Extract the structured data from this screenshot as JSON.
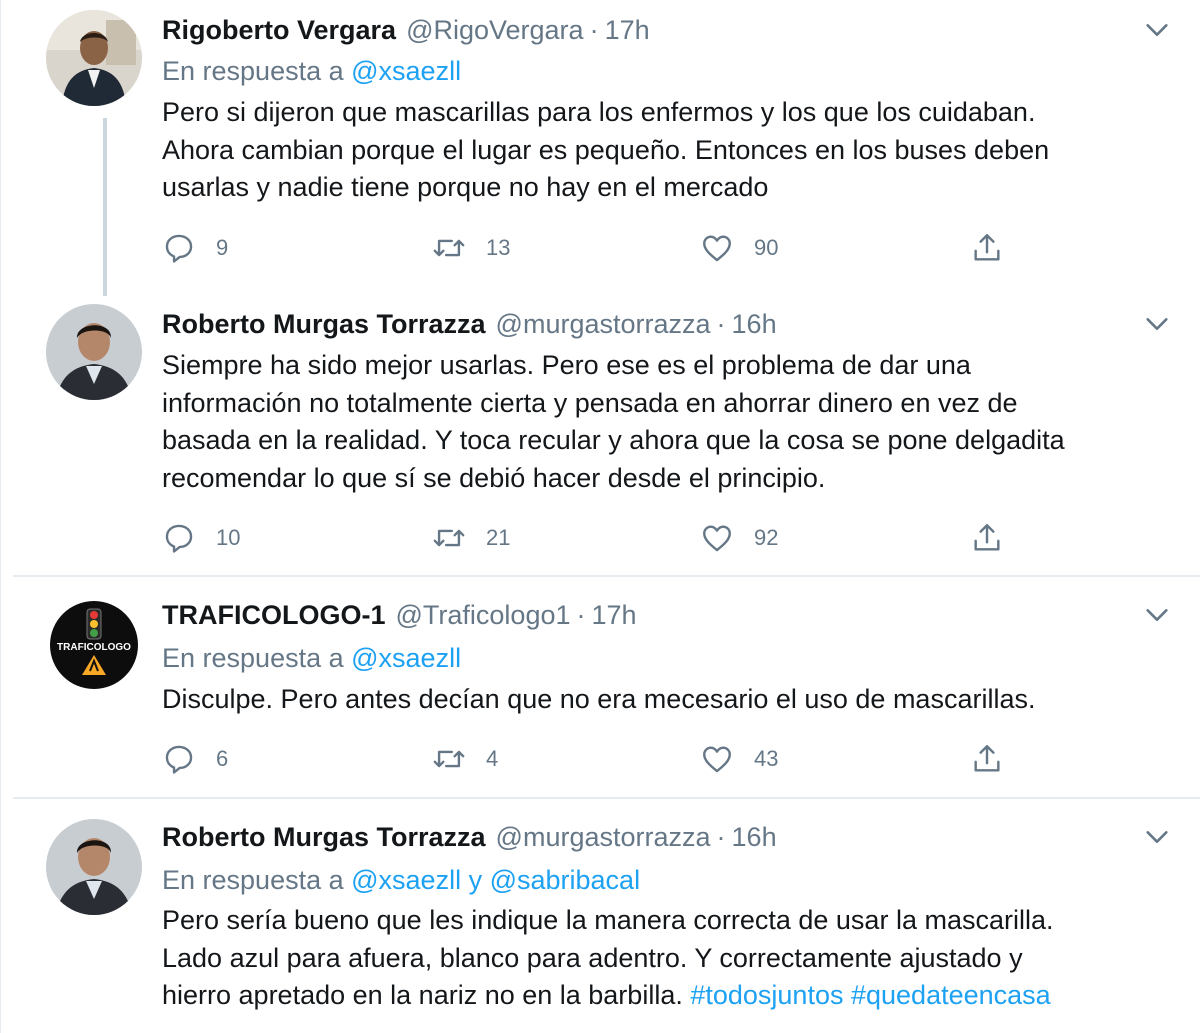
{
  "tweets": [
    {
      "name": "Rigoberto Vergara",
      "handle": "@RigoVergara",
      "dot": "·",
      "time": "17h",
      "reply_prefix": "En respuesta a ",
      "reply_to": "@xsaezll",
      "lines": [
        "Pero si dijeron que mascarillas para los enfermos y los que los cuidaban.",
        "Ahora cambian porque el lugar es pequeño. Entonces en los buses deben",
        "usarlas y nadie tiene porque no hay en el mercado"
      ],
      "replies": "9",
      "retweets": "13",
      "likes": "90"
    },
    {
      "name": "Roberto Murgas Torrazza",
      "handle": "@murgastorrazza",
      "dot": "·",
      "time": "16h",
      "lines": [
        "Siempre ha sido mejor usarlas. Pero ese es el problema de dar una",
        "información no totalmente cierta y pensada en ahorrar dinero en vez de",
        "basada en la realidad. Y toca recular y ahora que la cosa se pone delgadita",
        "recomendar lo que sí se debió hacer desde el principio."
      ],
      "replies": "10",
      "retweets": "21",
      "likes": "92"
    },
    {
      "name": "TRAFICOLOGO-1",
      "handle": "@Traficologo1",
      "dot": "·",
      "time": "17h",
      "reply_prefix": "En respuesta a ",
      "reply_to": "@xsaezll",
      "lines": [
        "Disculpe. Pero antes decían que no era mecesario el uso de mascarillas."
      ],
      "replies": "6",
      "retweets": "4",
      "likes": "43",
      "avatar_text": "TRAFICOLOGO"
    },
    {
      "name": "Roberto Murgas Torrazza",
      "handle": "@murgastorrazza",
      "dot": "·",
      "time": "16h",
      "reply_prefix": "En respuesta a ",
      "reply_to": "@xsaezll",
      "reply_and": " y ",
      "reply_to_2": "@sabribacal",
      "lines": [
        "Pero sería bueno que les indique la manera correcta de usar la mascarilla.",
        "Lado azul para afuera, blanco para adentro. Y correctamente ajustado y"
      ],
      "last_line_text": "hierro apretado en la nariz no en la barbilla. ",
      "hashtags": [
        "#todosjuntos",
        "#quedateencasa"
      ]
    }
  ],
  "icons": {
    "reply": "reply-icon",
    "retweet": "retweet-icon",
    "like": "heart-icon",
    "share": "share-icon",
    "more": "chevron-down-icon"
  },
  "colors": {
    "link": "#1da1f2",
    "muted": "#657786",
    "text": "#14171a",
    "divider": "#e6ecf0"
  }
}
